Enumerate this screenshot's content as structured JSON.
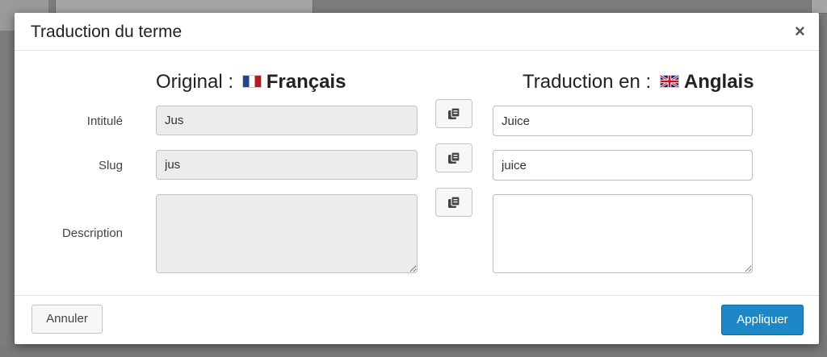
{
  "modal": {
    "title": "Traduction du terme",
    "close_glyph": "×"
  },
  "columns": {
    "original_prefix": "Original :",
    "original_language": "Français",
    "original_flag": "fr-flag",
    "translation_prefix": "Traduction en :",
    "translation_language": "Anglais",
    "translation_flag": "gb-flag"
  },
  "rows": {
    "name": {
      "label": "Intitulé",
      "original": "Jus",
      "translation": "Juice"
    },
    "slug": {
      "label": "Slug",
      "original": "jus",
      "translation": "juice"
    },
    "description": {
      "label": "Description",
      "original": "",
      "translation": ""
    }
  },
  "copy_icon": "copy-icon",
  "footer": {
    "cancel_label": "Annuler",
    "apply_label": "Appliquer"
  },
  "colors": {
    "apply_button": "#1e88c7",
    "readonly_field": "#ececec"
  }
}
